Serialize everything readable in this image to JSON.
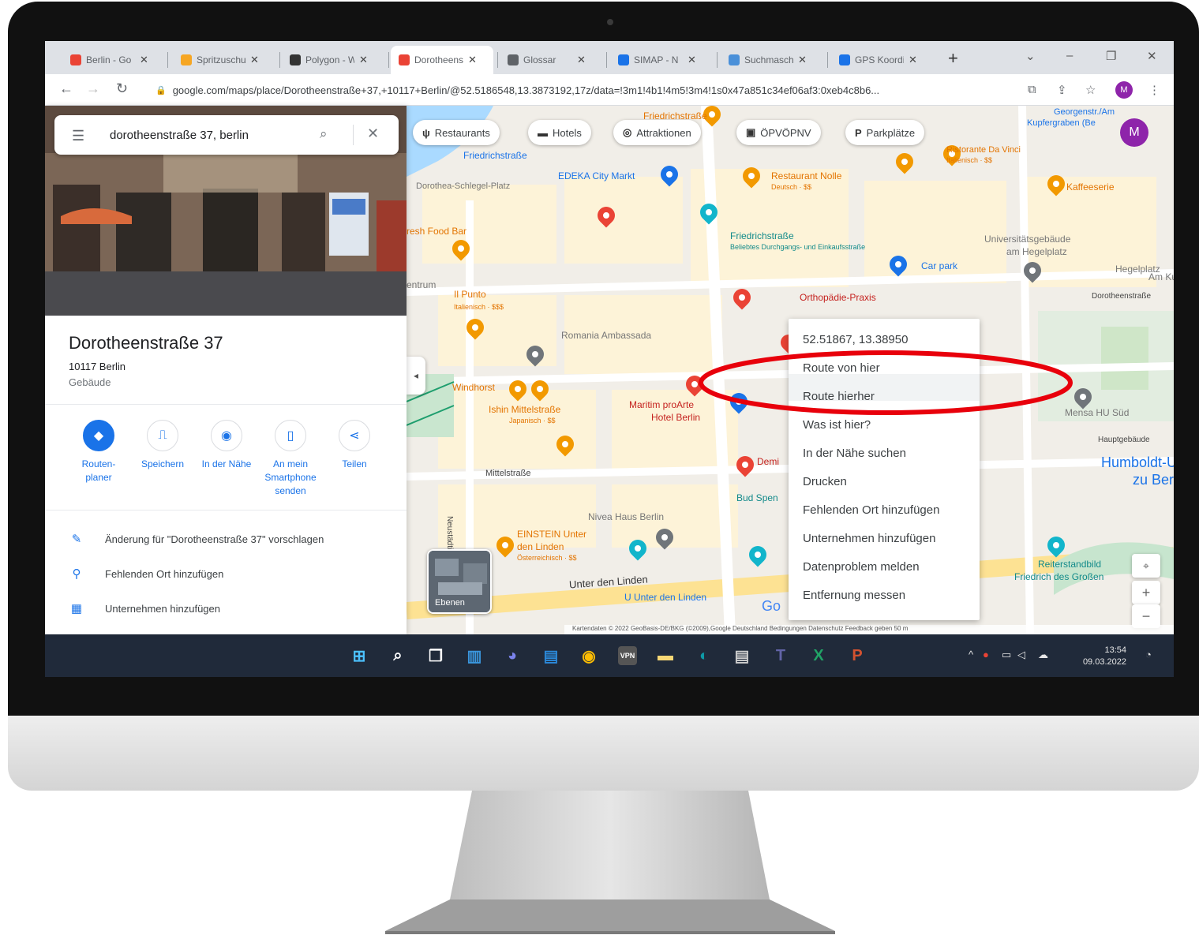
{
  "browser": {
    "tabs": [
      {
        "label": "Berlin - Go",
        "icon": "maps-pin-icon",
        "color": "#ea4335"
      },
      {
        "label": "Spritzuschu",
        "icon": "jobs-icon",
        "color": "#f6a623"
      },
      {
        "label": "Polygon - W",
        "icon": "wikipedia-icon",
        "color": "#333333"
      },
      {
        "label": "Dorotheens",
        "icon": "maps-pin-icon",
        "color": "#ea4335"
      },
      {
        "label": "Glossar",
        "icon": "glossary-icon",
        "color": "#5f6368"
      },
      {
        "label": "SIMAP - N",
        "icon": "monitor-icon",
        "color": "#1a73e8"
      },
      {
        "label": "Suchmasch",
        "icon": "search-engine-icon",
        "color": "#4a90d9"
      },
      {
        "label": "GPS Koordi",
        "icon": "gps-icon",
        "color": "#1a73e8"
      }
    ],
    "active_tab_index": 3,
    "url": "google.com/maps/place/Dorotheenstraße+37,+10117+Berlin/@52.5186548,13.3873192,17z/data=!3m1!4b1!4m5!3m4!1s0x47a851c34ef06af3:0xeb4c8b6...",
    "profile_initial": "M"
  },
  "panel": {
    "search_value": "dorotheenstraße 37, berlin",
    "title": "Dorotheenstraße 37",
    "address": "10117 Berlin",
    "type": "Gebäude",
    "actions": [
      {
        "label": "Routen-\nplaner",
        "icon": "directions-icon"
      },
      {
        "label": "Speichern",
        "icon": "bookmark-icon"
      },
      {
        "label": "In der Nähe",
        "icon": "nearby-icon"
      },
      {
        "label": "An mein\nSmartphone\nsenden",
        "icon": "send-to-phone-icon"
      },
      {
        "label": "Teilen",
        "icon": "share-icon"
      }
    ],
    "list": [
      {
        "label": "Änderung für \"Dorotheenstraße 37\" vorschlagen",
        "icon": "pencil-icon"
      },
      {
        "label": "Fehlenden Ort hinzufügen",
        "icon": "add-place-icon"
      },
      {
        "label": "Unternehmen hinzufügen",
        "icon": "add-business-icon"
      }
    ]
  },
  "map": {
    "chips": [
      {
        "label": "Restaurants",
        "icon": "fork-knife-icon"
      },
      {
        "label": "Hotels",
        "icon": "bed-icon"
      },
      {
        "label": "Attraktionen",
        "icon": "camera-icon"
      },
      {
        "label": "ÖPVÖPNV",
        "icon": "transit-icon"
      },
      {
        "label": "Parkplätze",
        "icon": "parking-icon"
      }
    ],
    "labels": {
      "friedrichstrasse_station": "Friedrichstraße",
      "friedrichstrasse_top": "Friedrichstraße",
      "edeka": "EDEKA City Markt",
      "dorothea_platz": "Dorothea-Schlegel-Platz",
      "restaurant_nolle": "Restaurant Nolle",
      "restaurant_nolle_sub": "Deutsch · $$",
      "ristorante": "Ristorante Da Vinci",
      "ristorante_sub": "Italienisch · $$",
      "kaffeeserie": "Kaffeeserie",
      "georgen": "Georgenstr./Am",
      "kupfergraben": "Kupfergraben (Be",
      "fresh_food": "resh Food Bar",
      "friedrichstrasse_poi": "Friedrichstraße",
      "friedrichstrasse_poi_sub": "Beliebtes Durchgangs- und Einkaufsstraße",
      "uni_gebaeude": "Universitätsgebäude",
      "uni_gebaeude_2": "am Hegelplatz",
      "car_park": "Car park",
      "hegelplatz": "Hegelplatz",
      "am_ku": "Am Ku",
      "il_punto": "Il Punto",
      "il_punto_sub": "Italienisch · $$$",
      "orthopaedie": "Orthopädie-Praxis",
      "dorotheenstrasse": "Dorotheenstraße",
      "romania": "Romania Ambassada",
      "windhorst": "Windhorst",
      "ishin": "Ishin Mittelstraße",
      "ishin_sub": "Japanisch · $$",
      "maritim": "Maritim proArte",
      "maritim_2": "Hotel Berlin",
      "mensa": "Mensa HU Süd",
      "hauptgebaeude": "Hauptgebäude",
      "humboldt": "Humboldt-Univer",
      "humboldt_2": "zu Berlin",
      "mittelstrasse": "Mittelstraße",
      "neustaedtische": "Neustädtische Kirchstr.",
      "demi": "Demi",
      "bud_spen": "Bud Spen",
      "nivea": "Nivea Haus Berlin",
      "einstein": "EINSTEIN Unter",
      "einstein_2": "den Linden",
      "einstein_sub": "Österreichisch · $$",
      "unter_den_linden": "Unter den Linden",
      "u_unter_den_linden": "U Unter den Linden",
      "reiterstandbild": "Reiterstandbild",
      "reiterstandbild_2": "Friedrich des Großen",
      "centrum": "entrum",
      "layers": "Ebenen",
      "go": "Go"
    },
    "footer": "Kartendaten © 2022 GeoBasis-DE/BKG (©2009),Google   Deutschland   Bedingungen   Datenschutz   Feedback geben   50 m",
    "context_menu": [
      "52.51867, 13.38950",
      "Route von hier",
      "Route hierher",
      "Was ist hier?",
      "In der Nähe suchen",
      "Drucken",
      "Fehlenden Ort hinzufügen",
      "Unternehmen hinzufügen",
      "Datenproblem melden",
      "Entfernung messen"
    ],
    "avatar_initial": "M"
  },
  "taskbar": {
    "apps": [
      {
        "icon": "windows-start-icon",
        "color": "#4cc2ff"
      },
      {
        "icon": "search-icon",
        "color": "#ffffff"
      },
      {
        "icon": "task-view-icon",
        "color": "#ffffff"
      },
      {
        "icon": "widgets-icon",
        "color": "#3a96dd"
      },
      {
        "icon": "teams-chat-icon",
        "color": "#7b83eb"
      },
      {
        "icon": "microsoft-store-icon",
        "color": "#2b88d8"
      },
      {
        "icon": "chrome-icon",
        "color": "#fbbc04"
      },
      {
        "icon": "vpn-icon",
        "color": "#666666"
      },
      {
        "icon": "file-explorer-icon",
        "color": "#f8d775"
      },
      {
        "icon": "edge-icon",
        "color": "#0e9aa7"
      },
      {
        "icon": "notepad-icon",
        "color": "#cccccc"
      },
      {
        "icon": "teams-icon",
        "color": "#6264a7"
      },
      {
        "icon": "excel-icon",
        "color": "#21a366"
      },
      {
        "icon": "powerpoint-icon",
        "color": "#d35230"
      }
    ],
    "vpn_label": "VPN",
    "time": "13:54",
    "date": "09.03.2022"
  },
  "annotation": {
    "ellipse_color": "#e8000b"
  }
}
